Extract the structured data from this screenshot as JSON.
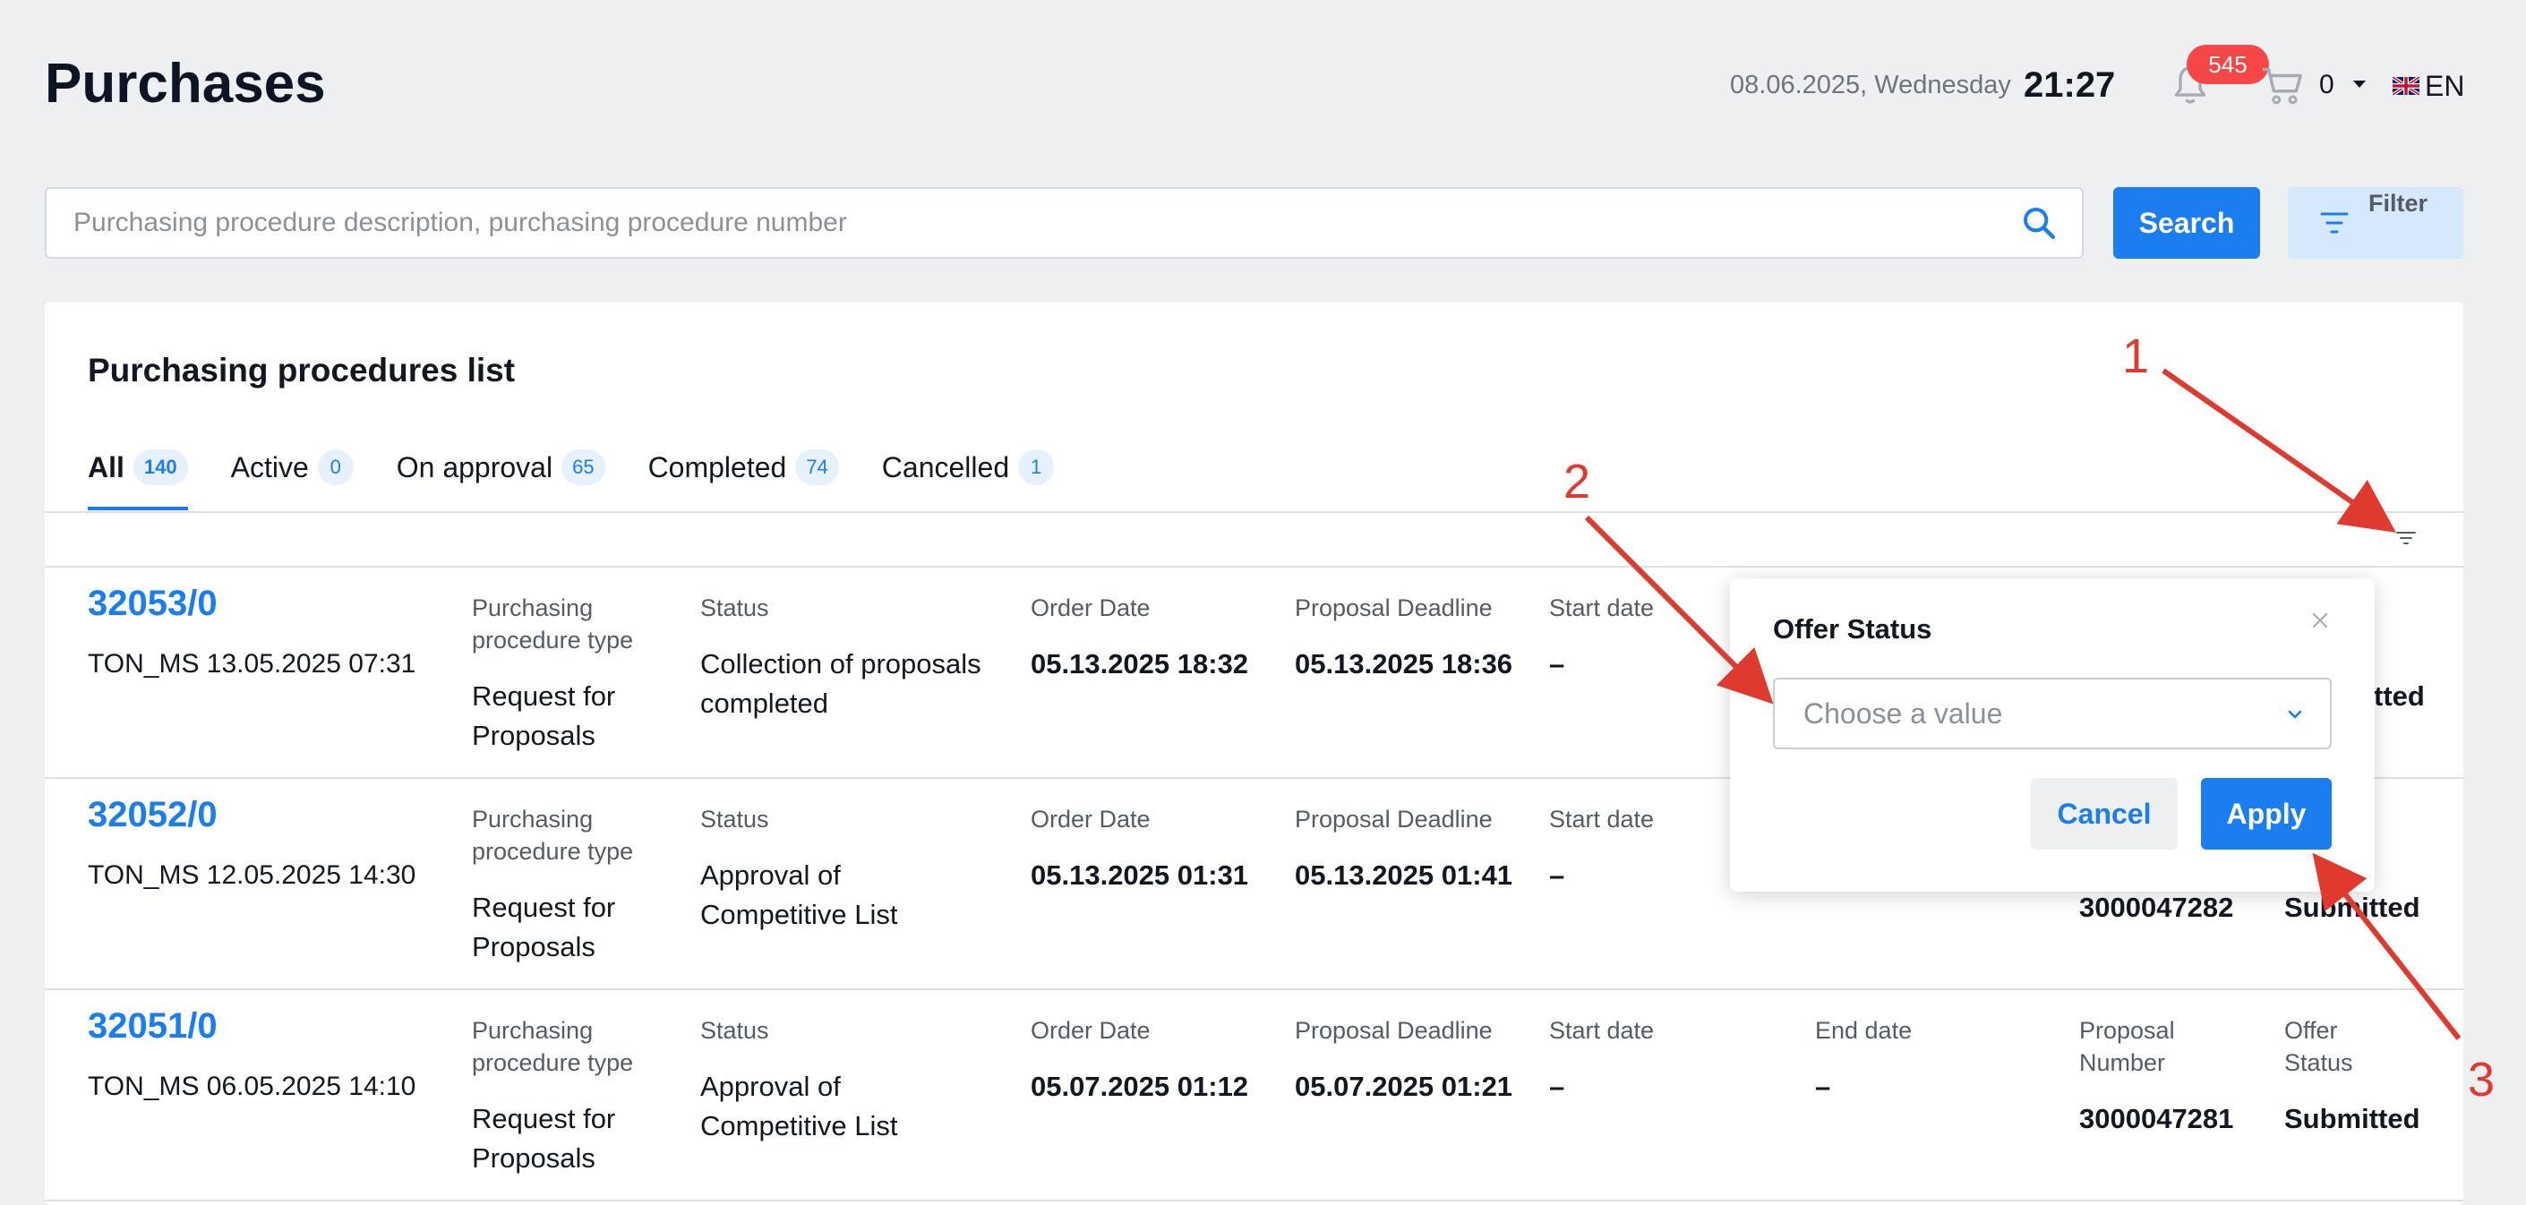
{
  "header": {
    "title": "Purchases",
    "date": "08.06.2025, Wednesday",
    "time": "21:27",
    "notifications_count": "545",
    "cart_count": "0",
    "language": "EN",
    "icons": [
      "bell-icon",
      "cart-icon",
      "chevron-down-icon",
      "uk-flag-icon"
    ]
  },
  "search": {
    "placeholder": "Purchasing procedure description, purchasing procedure number",
    "value": "",
    "search_label": "Search",
    "filter_label": "Filter"
  },
  "list": {
    "title": "Purchasing procedures list",
    "tabs": [
      {
        "label": "All",
        "count": "140",
        "active": true
      },
      {
        "label": "Active",
        "count": "0"
      },
      {
        "label": "On approval",
        "count": "65"
      },
      {
        "label": "Completed",
        "count": "74"
      },
      {
        "label": "Cancelled",
        "count": "1"
      }
    ],
    "column_labels": {
      "type": [
        "Purchasing",
        "procedure type"
      ],
      "status": "Status",
      "order_date": "Order Date",
      "proposal_deadline": "Proposal Deadline",
      "start_date": "Start date",
      "end_date": "End date",
      "proposal_number": [
        "Proposal",
        "Number"
      ],
      "offer_status": [
        "Offer",
        "Status"
      ]
    },
    "rows": [
      {
        "number": "32053/0",
        "subtitle": "TON_MS 13.05.2025 07:31",
        "type": [
          "Request for",
          "Proposals"
        ],
        "status": [
          "Collection of proposals",
          "completed"
        ],
        "order_date": "05.13.2025 18:32",
        "proposal_deadline": "05.13.2025 18:36",
        "start_date": "–",
        "offer_status_partial": "tted"
      },
      {
        "number": "32052/0",
        "subtitle": "TON_MS 12.05.2025 14:30",
        "type": [
          "Request for",
          "Proposals"
        ],
        "status": [
          "Approval of",
          "Competitive List"
        ],
        "order_date": "05.13.2025 01:31",
        "proposal_deadline": "05.13.2025 01:41",
        "start_date": "–",
        "proposal_number": "3000047282",
        "offer_status": "Submitted"
      },
      {
        "number": "32051/0",
        "subtitle": "TON_MS 06.05.2025 14:10",
        "type": [
          "Request for",
          "Proposals"
        ],
        "status": [
          "Approval of",
          "Competitive List"
        ],
        "order_date": "05.07.2025 01:12",
        "proposal_deadline": "05.07.2025 01:21",
        "start_date": "–",
        "end_date": "–",
        "proposal_number": "3000047281",
        "offer_status": "Submitted"
      }
    ]
  },
  "popup": {
    "title": "Offer Status",
    "select_placeholder": "Choose a value",
    "cancel_label": "Cancel",
    "apply_label": "Apply"
  },
  "annotations": {
    "labels": [
      "1",
      "2",
      "3"
    ],
    "color": "#e03a2f"
  },
  "colors": {
    "accent": "#1a7ef0",
    "badge": "#f64646",
    "background": "#eeeff1"
  }
}
